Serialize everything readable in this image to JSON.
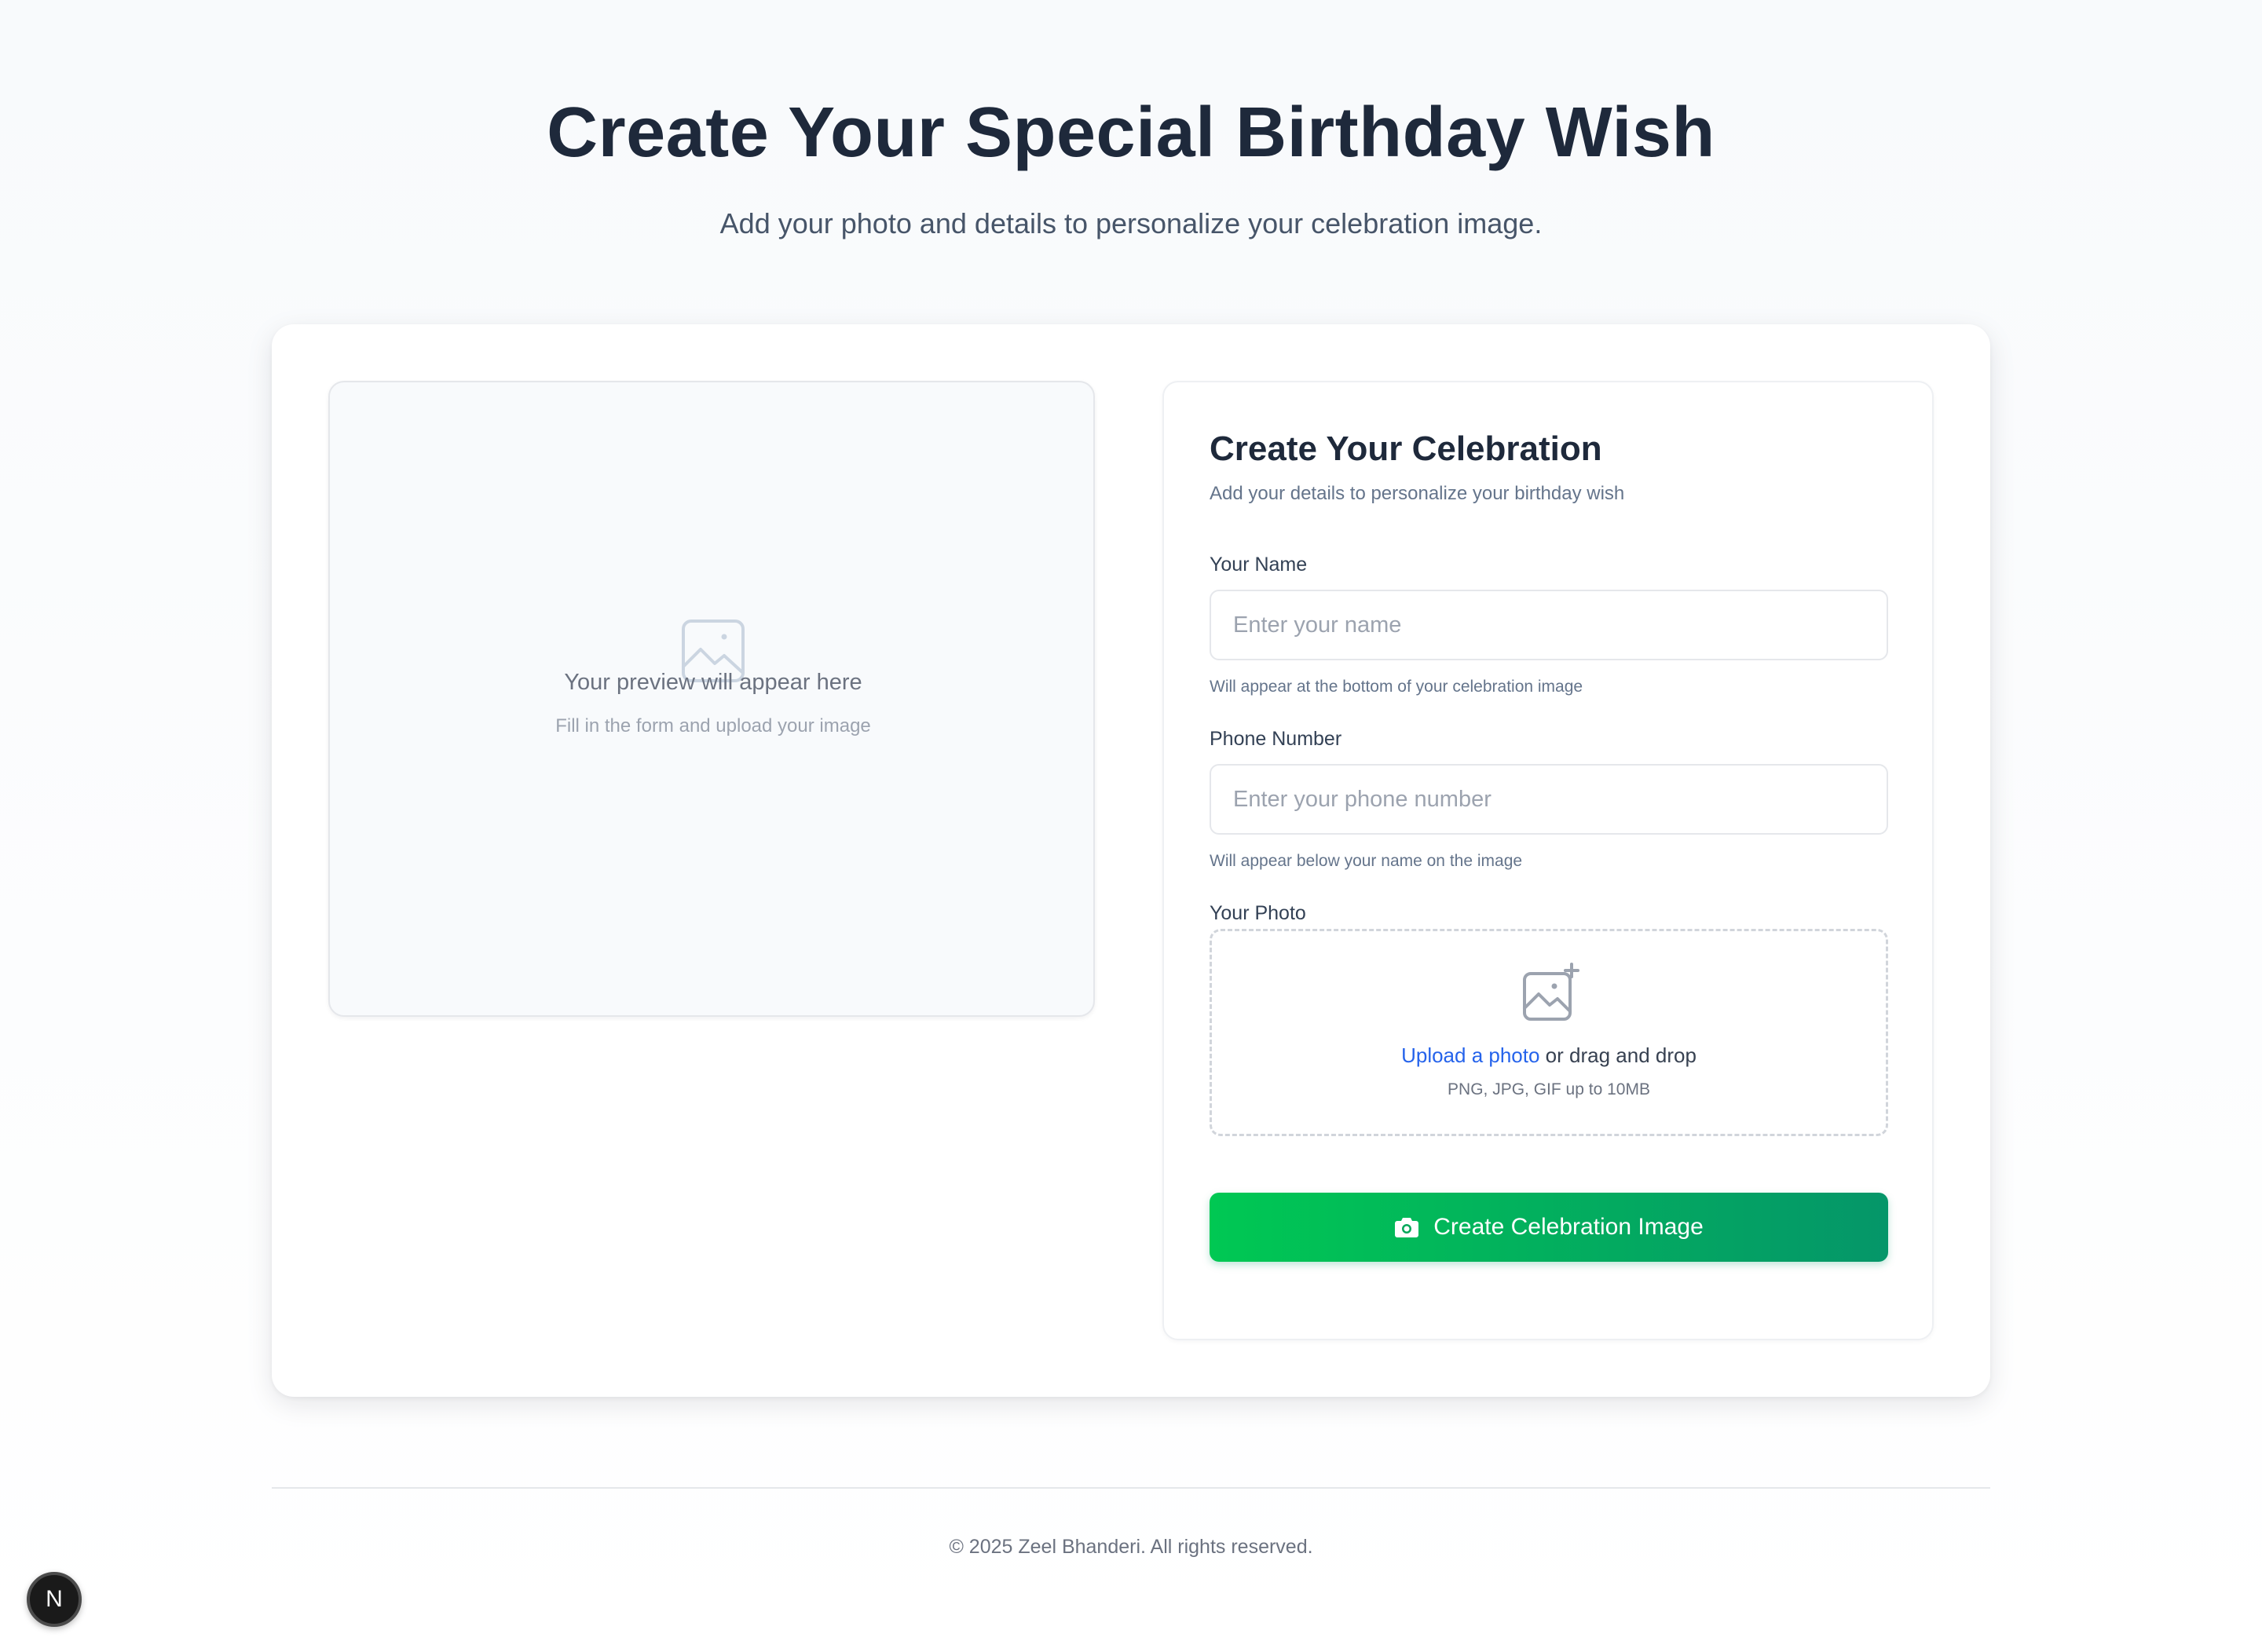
{
  "hero": {
    "title": "Create Your Special Birthday Wish",
    "subtitle": "Add your photo and details to personalize your celebration image."
  },
  "preview": {
    "icon": "image-placeholder-icon",
    "title": "Your preview will appear here",
    "subtitle": "Fill in the form and upload your image"
  },
  "form": {
    "title": "Create Your Celebration",
    "subtitle": "Add your details to personalize your birthday wish",
    "name": {
      "label": "Your Name",
      "value": "",
      "placeholder": "Enter your name",
      "hint": "Will appear at the bottom of your celebration image"
    },
    "phone": {
      "label": "Phone Number",
      "value": "",
      "placeholder": "Enter your phone number",
      "hint": "Will appear below your name on the image"
    },
    "photo": {
      "label": "Your Photo",
      "icon": "image-add-icon",
      "upload_link": "Upload a photo",
      "drag_text": " or drag and drop",
      "note": "PNG, JPG, GIF up to 10MB"
    },
    "submit": {
      "icon": "camera-icon",
      "label": "Create Celebration Image"
    }
  },
  "footer": {
    "copyright": "© 2025 Zeel Bhanderi. All rights reserved."
  },
  "dev_badge": {
    "letter": "N"
  },
  "colors": {
    "heading": "#1e293b",
    "link": "#2563eb",
    "cta_start": "#00c853",
    "cta_end": "#059669",
    "muted": "#64748b"
  }
}
